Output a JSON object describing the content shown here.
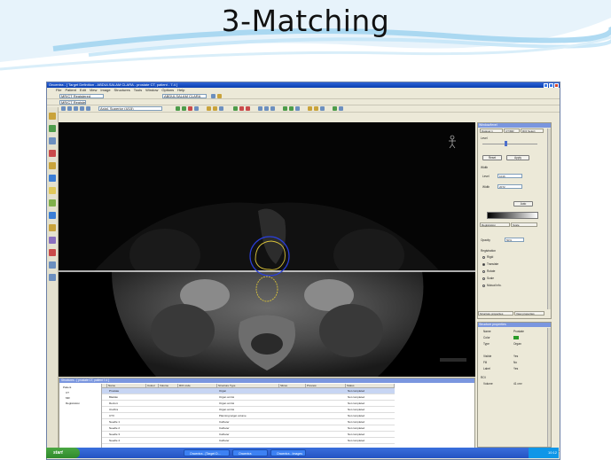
{
  "slide": {
    "title": "3-Matching"
  },
  "app": {
    "window_title": "Oncentra - [ Target Definition - ABDULSALAM CLARA - prostate CT, patient - 7.4 ]",
    "menu": [
      "File",
      "Patient",
      "Edit",
      "View",
      "Image",
      "Structures",
      "Tools",
      "Window",
      "Options",
      "Help"
    ],
    "image_set_combo": "MR/CT Registered",
    "patient_combo": "ABDULSALAM CLARA",
    "orientation_combo": "Axial, Superior (4/15)",
    "right_panel": {
      "title": "Window/level",
      "tabs": [
        "Dataset 1",
        "CT/MR",
        "ROI Select"
      ],
      "level_label": "Level",
      "width_label": "Width",
      "level_value": "1016",
      "width_value": "2072",
      "reset_button": "Reset",
      "apply_button": "Apply",
      "auto_button": "Auto",
      "registration_title": "Registration",
      "scale_label": "Scale",
      "opacity_label": "Opacity",
      "opacity_value": "50%",
      "options": [
        "Rigid",
        "Translate",
        "Rotate",
        "Scale",
        "Mutual info."
      ],
      "bottom_tabs": [
        "Structure properties",
        "View properties"
      ]
    },
    "properties_panel": {
      "title": "Structure properties",
      "rows": [
        {
          "label": "Name",
          "value": "Prostate"
        },
        {
          "label": "Color",
          "value": ""
        },
        {
          "label": "Type",
          "value": "Organ"
        },
        {
          "label": "Visible",
          "value": "Yes"
        },
        {
          "label": "Fill",
          "value": "No"
        },
        {
          "label": "Label",
          "value": "Yes"
        }
      ],
      "roi_label": "ROI",
      "volume_label": "Volume",
      "volume_value": "41 cm³"
    },
    "bottom_panel": {
      "title": "Structures - [ prostate CT, patient 7.4 ]",
      "tree": [
        "Patient",
        "CT",
        "MR",
        "Registration"
      ],
      "columns": [
        "",
        "Name",
        "Colour",
        "Volume",
        "ROI code",
        "Structure Type",
        "Slices",
        "Preview",
        "Status"
      ],
      "rows": [
        {
          "name": "Prostate",
          "type": "Organ",
          "status": "Not completed"
        },
        {
          "name": "Bladder",
          "type": "Organ at risk",
          "status": "Not completed"
        },
        {
          "name": "Rectum",
          "type": "Organ at risk",
          "status": "Not completed"
        },
        {
          "name": "Urethra",
          "type": "Organ at risk",
          "status": "Not completed"
        },
        {
          "name": "CTV",
          "type": "Planning target volume",
          "status": "Not completed"
        },
        {
          "name": "Needle 1",
          "type": "Catheter",
          "status": "Not completed"
        },
        {
          "name": "Needle 2",
          "type": "Catheter",
          "status": "Not completed"
        },
        {
          "name": "Needle 3",
          "type": "Catheter",
          "status": "Not completed"
        },
        {
          "name": "Needle 4",
          "type": "Catheter",
          "status": "Not completed"
        }
      ]
    },
    "status_text": "Ready"
  },
  "taskbar": {
    "start_label": "start",
    "tasks": [
      "Oncentra - [Target D...",
      "Oncentra",
      "Oncentra - Images"
    ],
    "clock": "10:12"
  },
  "colors": {
    "titlebar": "#0a3fb0",
    "panel_bg": "#ece9d8",
    "viewer_bg": "#000000",
    "contour_blue": "#2a3fd8",
    "contour_yellow": "#d8c23a",
    "registration_line": "#e8e8e8"
  }
}
